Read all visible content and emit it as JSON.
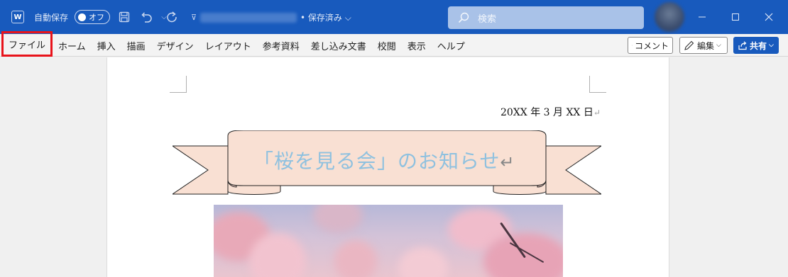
{
  "titlebar": {
    "app_icon": "W",
    "autosave_label": "自動保存",
    "autosave_state": "オフ",
    "status": "• 保存済み ⌵",
    "search_placeholder": "検索"
  },
  "ribbon": {
    "tabs": [
      "ファイル",
      "ホーム",
      "挿入",
      "描画",
      "デザイン",
      "レイアウト",
      "参考資料",
      "差し込み文書",
      "校閲",
      "表示",
      "ヘルプ"
    ],
    "comment_label": "コメント",
    "edit_label": "編集",
    "share_label": "共有"
  },
  "document": {
    "date": "20XX 年 3 月 XX 日",
    "title": "「桜を見る会」のお知らせ",
    "paragraph_mark": "↵"
  },
  "colors": {
    "titlebar": "#185abd",
    "highlight": "#e8131b",
    "banner_fill": "#f9e0d3",
    "title_text": "#8fc1df"
  }
}
